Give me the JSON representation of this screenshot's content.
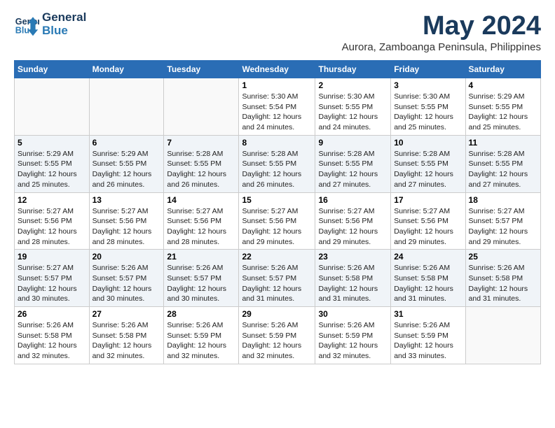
{
  "logo": {
    "line1": "General",
    "line2": "Blue"
  },
  "title": "May 2024",
  "location": "Aurora, Zamboanga Peninsula, Philippines",
  "weekdays": [
    "Sunday",
    "Monday",
    "Tuesday",
    "Wednesday",
    "Thursday",
    "Friday",
    "Saturday"
  ],
  "weeks": [
    [
      {
        "day": "",
        "info": ""
      },
      {
        "day": "",
        "info": ""
      },
      {
        "day": "",
        "info": ""
      },
      {
        "day": "1",
        "info": "Sunrise: 5:30 AM\nSunset: 5:54 PM\nDaylight: 12 hours\nand 24 minutes."
      },
      {
        "day": "2",
        "info": "Sunrise: 5:30 AM\nSunset: 5:55 PM\nDaylight: 12 hours\nand 24 minutes."
      },
      {
        "day": "3",
        "info": "Sunrise: 5:30 AM\nSunset: 5:55 PM\nDaylight: 12 hours\nand 25 minutes."
      },
      {
        "day": "4",
        "info": "Sunrise: 5:29 AM\nSunset: 5:55 PM\nDaylight: 12 hours\nand 25 minutes."
      }
    ],
    [
      {
        "day": "5",
        "info": "Sunrise: 5:29 AM\nSunset: 5:55 PM\nDaylight: 12 hours\nand 25 minutes."
      },
      {
        "day": "6",
        "info": "Sunrise: 5:29 AM\nSunset: 5:55 PM\nDaylight: 12 hours\nand 26 minutes."
      },
      {
        "day": "7",
        "info": "Sunrise: 5:28 AM\nSunset: 5:55 PM\nDaylight: 12 hours\nand 26 minutes."
      },
      {
        "day": "8",
        "info": "Sunrise: 5:28 AM\nSunset: 5:55 PM\nDaylight: 12 hours\nand 26 minutes."
      },
      {
        "day": "9",
        "info": "Sunrise: 5:28 AM\nSunset: 5:55 PM\nDaylight: 12 hours\nand 27 minutes."
      },
      {
        "day": "10",
        "info": "Sunrise: 5:28 AM\nSunset: 5:55 PM\nDaylight: 12 hours\nand 27 minutes."
      },
      {
        "day": "11",
        "info": "Sunrise: 5:28 AM\nSunset: 5:55 PM\nDaylight: 12 hours\nand 27 minutes."
      }
    ],
    [
      {
        "day": "12",
        "info": "Sunrise: 5:27 AM\nSunset: 5:56 PM\nDaylight: 12 hours\nand 28 minutes."
      },
      {
        "day": "13",
        "info": "Sunrise: 5:27 AM\nSunset: 5:56 PM\nDaylight: 12 hours\nand 28 minutes."
      },
      {
        "day": "14",
        "info": "Sunrise: 5:27 AM\nSunset: 5:56 PM\nDaylight: 12 hours\nand 28 minutes."
      },
      {
        "day": "15",
        "info": "Sunrise: 5:27 AM\nSunset: 5:56 PM\nDaylight: 12 hours\nand 29 minutes."
      },
      {
        "day": "16",
        "info": "Sunrise: 5:27 AM\nSunset: 5:56 PM\nDaylight: 12 hours\nand 29 minutes."
      },
      {
        "day": "17",
        "info": "Sunrise: 5:27 AM\nSunset: 5:56 PM\nDaylight: 12 hours\nand 29 minutes."
      },
      {
        "day": "18",
        "info": "Sunrise: 5:27 AM\nSunset: 5:57 PM\nDaylight: 12 hours\nand 29 minutes."
      }
    ],
    [
      {
        "day": "19",
        "info": "Sunrise: 5:27 AM\nSunset: 5:57 PM\nDaylight: 12 hours\nand 30 minutes."
      },
      {
        "day": "20",
        "info": "Sunrise: 5:26 AM\nSunset: 5:57 PM\nDaylight: 12 hours\nand 30 minutes."
      },
      {
        "day": "21",
        "info": "Sunrise: 5:26 AM\nSunset: 5:57 PM\nDaylight: 12 hours\nand 30 minutes."
      },
      {
        "day": "22",
        "info": "Sunrise: 5:26 AM\nSunset: 5:57 PM\nDaylight: 12 hours\nand 31 minutes."
      },
      {
        "day": "23",
        "info": "Sunrise: 5:26 AM\nSunset: 5:58 PM\nDaylight: 12 hours\nand 31 minutes."
      },
      {
        "day": "24",
        "info": "Sunrise: 5:26 AM\nSunset: 5:58 PM\nDaylight: 12 hours\nand 31 minutes."
      },
      {
        "day": "25",
        "info": "Sunrise: 5:26 AM\nSunset: 5:58 PM\nDaylight: 12 hours\nand 31 minutes."
      }
    ],
    [
      {
        "day": "26",
        "info": "Sunrise: 5:26 AM\nSunset: 5:58 PM\nDaylight: 12 hours\nand 32 minutes."
      },
      {
        "day": "27",
        "info": "Sunrise: 5:26 AM\nSunset: 5:58 PM\nDaylight: 12 hours\nand 32 minutes."
      },
      {
        "day": "28",
        "info": "Sunrise: 5:26 AM\nSunset: 5:59 PM\nDaylight: 12 hours\nand 32 minutes."
      },
      {
        "day": "29",
        "info": "Sunrise: 5:26 AM\nSunset: 5:59 PM\nDaylight: 12 hours\nand 32 minutes."
      },
      {
        "day": "30",
        "info": "Sunrise: 5:26 AM\nSunset: 5:59 PM\nDaylight: 12 hours\nand 32 minutes."
      },
      {
        "day": "31",
        "info": "Sunrise: 5:26 AM\nSunset: 5:59 PM\nDaylight: 12 hours\nand 33 minutes."
      },
      {
        "day": "",
        "info": ""
      }
    ]
  ]
}
